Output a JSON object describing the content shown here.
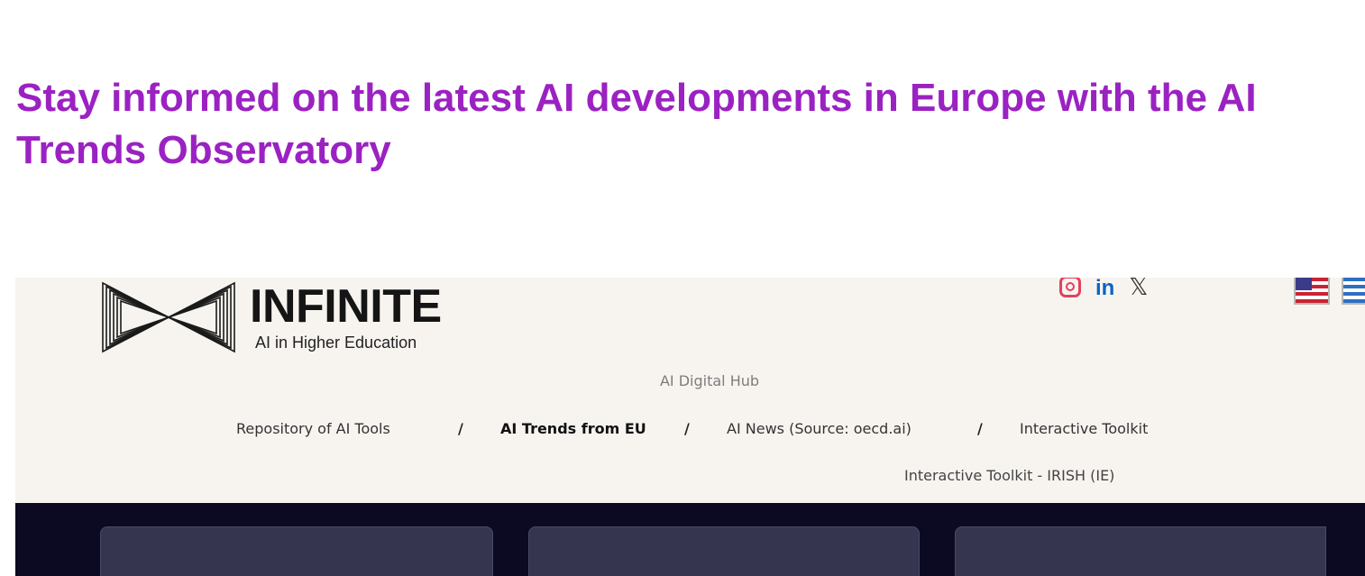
{
  "slide": {
    "title": "Stay informed on the latest AI developments in Europe with the AI Trends Observatory",
    "title_color": "#9b22c2"
  },
  "site": {
    "logo": {
      "name": "INFINITE",
      "tagline": "AI in Higher Education"
    },
    "social_icons": [
      "instagram-icon",
      "linkedin-icon",
      "x-icon"
    ],
    "language_flags": [
      "us-flag",
      "greek-flag"
    ],
    "hub_label": "AI Digital Hub",
    "nav": {
      "items": [
        {
          "label": "Repository of AI Tools",
          "active": false
        },
        {
          "label": "AI Trends from EU",
          "active": true
        },
        {
          "label": "AI News (Source: oecd.ai)",
          "active": false
        },
        {
          "label": "Interactive Toolkit",
          "active": false
        }
      ],
      "separator": "/",
      "sub_item": "Interactive Toolkit - IRISH (IE)"
    },
    "colors": {
      "page_background": "#f7f4f0",
      "dark_band": "#0b0a22",
      "card": "#353550"
    }
  }
}
